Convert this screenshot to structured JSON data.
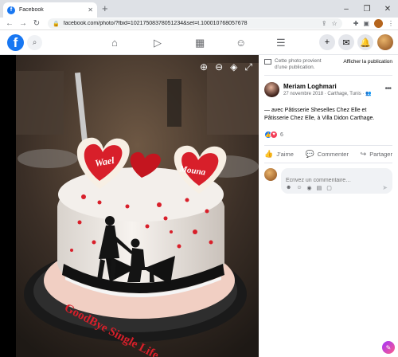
{
  "browser": {
    "tab_title": "Facebook",
    "tab_favicon": "f",
    "url": "facebook.com/photo/?fbid=10217508378051234&set=t.100010768057678"
  },
  "fb": {
    "logo": "f"
  },
  "photo": {
    "cake_name_left": "Wael",
    "cake_name_right": "Mouna",
    "cake_text": "GoodBye Single Life"
  },
  "panel": {
    "notice_text": "Cette photo provient d’une publication.",
    "notice_button": "Afficher la publication",
    "author_name": "Meriam Loghmari",
    "author_meta": "27 novembre 2018 · Carthage, Tunis ·",
    "caption": "— avec Pâtisserie Sheselles Chez Elle et Pâtisserie Chez Elle, à Villa Didon Carthage.",
    "reaction_count": "6",
    "like_label": "J’aime",
    "comment_label": "Commenter",
    "share_label": "Partager",
    "comment_placeholder": "Écrivez un commentaire…"
  },
  "colors": {
    "brand": "#1877f2",
    "cake_red": "#d81f2a"
  }
}
